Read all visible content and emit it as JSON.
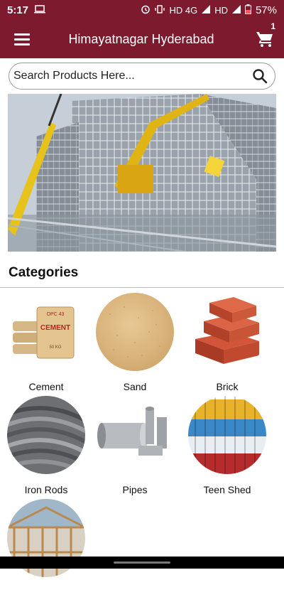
{
  "status": {
    "time": "5:17",
    "network": "HD 4G",
    "network2": "HD",
    "battery": "57%"
  },
  "appbar": {
    "title": "Himayatnagar Hyderabad",
    "cart_count": "1"
  },
  "search": {
    "placeholder": "Search Products Here..."
  },
  "categories_title": "Categories",
  "categories": [
    {
      "label": "Cement"
    },
    {
      "label": "Sand"
    },
    {
      "label": "Brick"
    },
    {
      "label": "Iron Rods"
    },
    {
      "label": "Pipes"
    },
    {
      "label": "Teen Shed"
    },
    {
      "label": ""
    }
  ],
  "cement_bag": {
    "brand": "OPC 43",
    "name": "CEMENT",
    "weight": "50 KG"
  },
  "colors": {
    "primary": "#7d1a2d"
  }
}
